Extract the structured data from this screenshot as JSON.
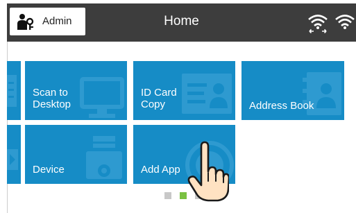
{
  "header": {
    "admin_label": "Admin",
    "title": "Home",
    "admin_icon": "user-key-icon",
    "wifi_icons": [
      "wifi-direct-icon",
      "wifi-icon"
    ]
  },
  "tiles": [
    {
      "label": "Scan to\nDesktop",
      "icon": "monitor-icon"
    },
    {
      "label": "ID Card\nCopy",
      "icon": "id-card-icon"
    },
    {
      "label": "Address Book",
      "icon": "contact-book-icon"
    },
    {
      "label": "Device",
      "icon": "printer-gear-icon"
    },
    {
      "label": "Add App",
      "icon": "add-app-icon"
    }
  ],
  "pagination": {
    "pages": 3,
    "current": 2
  },
  "colors": {
    "tile": "#168cc6",
    "header": "#3d3d3d",
    "active_dot": "#7ac142",
    "inactive_dot": "#c8c8c8"
  }
}
